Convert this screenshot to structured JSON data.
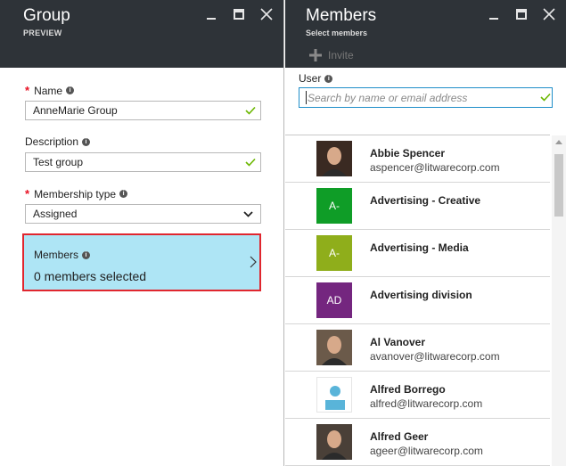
{
  "group_blade": {
    "title": "Group",
    "subtitle": "PREVIEW",
    "name": {
      "label": "Name",
      "value": "AnneMarie Group"
    },
    "description": {
      "label": "Description",
      "value": "Test group"
    },
    "membership_type": {
      "label": "Membership type",
      "value": "Assigned"
    },
    "members": {
      "label": "Members",
      "value": "0 members selected"
    }
  },
  "members_blade": {
    "title": "Members",
    "subtitle": "Select members",
    "invite_label": "Invite",
    "user_label": "User",
    "search_placeholder": "Search by name or email address",
    "members": [
      {
        "name": "Abbie Spencer",
        "email": "aspencer@litwarecorp.com",
        "initials": "",
        "color": "#3a2a22"
      },
      {
        "name": "Advertising - Creative",
        "email": "",
        "initials": "A-",
        "color": "#0f9d27"
      },
      {
        "name": "Advertising - Media",
        "email": "",
        "initials": "A-",
        "color": "#8fae1b"
      },
      {
        "name": "Advertising division",
        "email": "",
        "initials": "AD",
        "color": "#74267f"
      },
      {
        "name": "Al Vanover",
        "email": "avanover@litwarecorp.com",
        "initials": "",
        "color": "#6b5a4a"
      },
      {
        "name": "Alfred Borrego",
        "email": "alfred@litwarecorp.com",
        "initials": "",
        "color": "#59b4d9"
      },
      {
        "name": "Alfred Geer",
        "email": "ageer@litwarecorp.com",
        "initials": "",
        "color": "#4a4038"
      }
    ]
  },
  "colors": {
    "header_bg": "#2e3338",
    "selected_tile": "#aee5f5",
    "highlight_border": "#e0262e",
    "valid_check": "#6bb700",
    "focus_border": "#1f8ec9",
    "required": "#e81123"
  },
  "icons": [
    "minimize-icon",
    "maximize-icon",
    "close-icon",
    "info-icon",
    "checkmark-icon",
    "chevron-down-icon",
    "chevron-right-icon",
    "plus-icon"
  ]
}
